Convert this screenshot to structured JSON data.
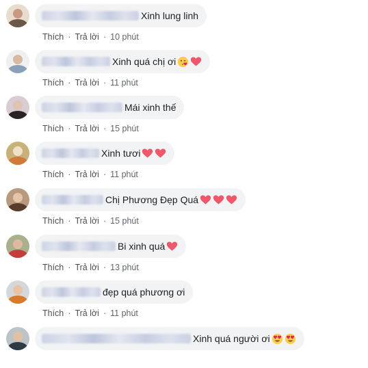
{
  "actions": {
    "like": "Thích",
    "reply": "Trả lời",
    "separator": "·"
  },
  "comments": [
    {
      "text": "Xinh lung linh",
      "time": "10 phút",
      "emojis": []
    },
    {
      "text": "Xinh quá chị ơi",
      "time": "11 phút",
      "emojis": [
        "kiss-emoji",
        "heart-icon"
      ]
    },
    {
      "text": "Mái xinh thế",
      "time": "15 phút",
      "emojis": []
    },
    {
      "text": "Xinh tươi",
      "time": "11 phút",
      "emojis": [
        "heart-icon",
        "heart-icon"
      ]
    },
    {
      "text": "Chị Phương Đẹp Quá",
      "time": "15 phút",
      "emojis": [
        "heart-icon",
        "heart-icon",
        "heart-icon"
      ]
    },
    {
      "text": "Bi xinh quá",
      "time": "13 phút",
      "emojis": [
        "heart-icon"
      ]
    },
    {
      "text": "đẹp quá phương ơi",
      "time": "11 phút",
      "emojis": []
    },
    {
      "text": "Xinh quá người ơi",
      "time": "",
      "emojis": [
        "heart-eyes-emoji",
        "heart-eyes-emoji"
      ]
    }
  ],
  "colors": {
    "bubble": "#f2f3f5",
    "meta": "#606770",
    "heart": "#f0576a"
  }
}
